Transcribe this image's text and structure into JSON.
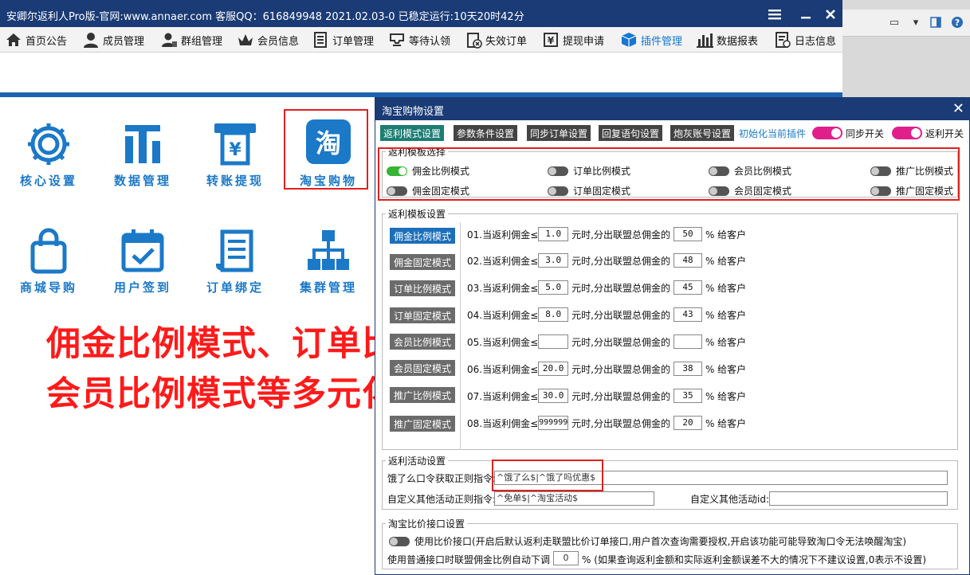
{
  "window": {
    "title": "安卿尔返利人Pro版-官网:www.annaer.com 客服QQ：616849948  2021.02.03-0   已稳定运行:10天20时42分"
  },
  "menu": [
    {
      "label": "首页公告",
      "icon": "home-icon"
    },
    {
      "label": "成员管理",
      "icon": "user-icon"
    },
    {
      "label": "群组管理",
      "icon": "group-icon"
    },
    {
      "label": "会员信息",
      "icon": "crown-icon"
    },
    {
      "label": "订单管理",
      "icon": "list-icon"
    },
    {
      "label": "等待认领",
      "icon": "inbox-icon"
    },
    {
      "label": "失效订单",
      "icon": "clipboard-x-icon"
    },
    {
      "label": "提现申请",
      "icon": "yuan-icon"
    },
    {
      "label": "插件管理",
      "icon": "cube-icon",
      "active": true
    },
    {
      "label": "数据报表",
      "icon": "bar-chart-icon"
    },
    {
      "label": "日志信息",
      "icon": "log-icon"
    }
  ],
  "tiles": [
    {
      "label": "核心设置",
      "icon": "gear-icon"
    },
    {
      "label": "数据管理",
      "icon": "data-icon"
    },
    {
      "label": "转账提现",
      "icon": "atm-icon"
    },
    {
      "label": "淘宝购物",
      "icon": "taobao-icon",
      "glyph": "淘",
      "selected": true
    },
    {
      "label": "商城导购",
      "icon": "shopping-bag-icon"
    },
    {
      "label": "用户签到",
      "icon": "calendar-check-icon"
    },
    {
      "label": "订单绑定",
      "icon": "scroll-icon"
    },
    {
      "label": "集群管理",
      "icon": "sitemap-icon"
    }
  ],
  "overlay": {
    "line1": "佣金比例模式、订单比例模式（杀熟模式）",
    "line2": "会员比例模式等多元化选择"
  },
  "dialog": {
    "title": "淘宝购物设置",
    "tabs": [
      "返利模式设置",
      "参数条件设置",
      "同步订单设置",
      "回复语句设置",
      "炮灰账号设置"
    ],
    "init_link": "初始化当前插件",
    "sync_switch": "同步开关",
    "rebate_switch": "返利开关",
    "template_select": {
      "legend": "返利模板选择",
      "options": [
        {
          "label": "佣金比例模式",
          "on": true
        },
        {
          "label": "订单比例模式",
          "on": false
        },
        {
          "label": "会员比例模式",
          "on": false
        },
        {
          "label": "推广比例模式",
          "on": false
        },
        {
          "label": "佣金固定模式",
          "on": false
        },
        {
          "label": "订单固定模式",
          "on": false
        },
        {
          "label": "会员固定模式",
          "on": false
        },
        {
          "label": "推广固定模式",
          "on": false
        }
      ]
    },
    "template_settings": {
      "legend": "返利模板设置",
      "side_buttons": [
        "佣金比例模式",
        "佣金固定模式",
        "订单比例模式",
        "订单固定模式",
        "会员比例模式",
        "会员固定模式",
        "推广比例模式",
        "推广固定模式"
      ],
      "rows": [
        {
          "prefix": "01.当返利佣金≤",
          "threshold": "1.0",
          "mid": "元时,分出联盟总佣金的",
          "percent": "50",
          "suffix": "% 给客户"
        },
        {
          "prefix": "02.当返利佣金≤",
          "threshold": "3.0",
          "mid": "元时,分出联盟总佣金的",
          "percent": "48",
          "suffix": "% 给客户"
        },
        {
          "prefix": "03.当返利佣金≤",
          "threshold": "5.0",
          "mid": "元时,分出联盟总佣金的",
          "percent": "45",
          "suffix": "% 给客户"
        },
        {
          "prefix": "04.当返利佣金≤",
          "threshold": "8.0",
          "mid": "元时,分出联盟总佣金的",
          "percent": "43",
          "suffix": "% 给客户"
        },
        {
          "prefix": "05.当返利佣金≤",
          "threshold": "",
          "mid": "元时,分出联盟总佣金的",
          "percent": "",
          "suffix": "% 给客户"
        },
        {
          "prefix": "06.当返利佣金≤",
          "threshold": "20.0",
          "mid": "元时,分出联盟总佣金的",
          "percent": "38",
          "suffix": "% 给客户"
        },
        {
          "prefix": "07.当返利佣金≤",
          "threshold": "30.0",
          "mid": "元时,分出联盟总佣金的",
          "percent": "35",
          "suffix": "% 给客户"
        },
        {
          "prefix": "08.当返利佣金≤",
          "threshold": "999999",
          "mid": "元时,分出联盟总佣金的",
          "percent": "20",
          "suffix": "% 给客户"
        }
      ]
    },
    "activity": {
      "legend": "返利活动设置",
      "eleme_label": "饿了么口令获取正则指令:",
      "eleme_value": "^饿了么$|^饿了吗优惠$",
      "custom_label": "自定义其他活动正则指令:",
      "custom_value": "^免单$|^淘宝活动$",
      "custom_id_label": "自定义其他活动id:",
      "custom_id_value": ""
    },
    "price_api": {
      "legend": "淘宝比价接口设置",
      "toggle_label": "使用比价接口(开启后默认返利走联盟比价订单接口,用户首次查询需要授权,开启该功能可能导致淘口令无法唤醒淘宝)",
      "adjust_label": "使用普通接口时联盟佣金比例自动下调",
      "adjust_value": "0",
      "adjust_suffix": "% (如果查询返利金额和实际返利金额误差不大的情况下不建议设置,0表示不设置)"
    }
  }
}
